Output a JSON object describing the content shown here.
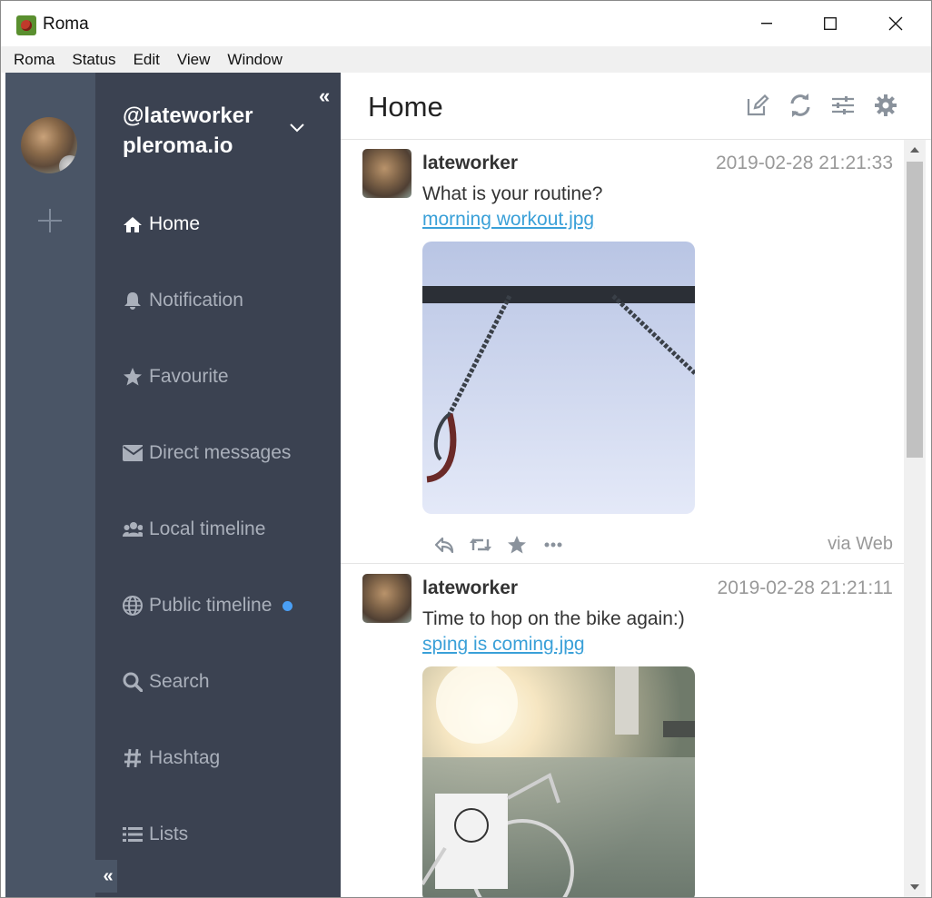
{
  "window": {
    "title": "Roma"
  },
  "menu": {
    "items": [
      "Roma",
      "Status",
      "Edit",
      "View",
      "Window"
    ]
  },
  "account": {
    "handle": "@lateworker",
    "domain": "pleroma.io"
  },
  "nav": {
    "items": [
      {
        "label": "Home",
        "icon": "home-icon",
        "active": true
      },
      {
        "label": "Notification",
        "icon": "bell-icon"
      },
      {
        "label": "Favourite",
        "icon": "star-icon"
      },
      {
        "label": "Direct messages",
        "icon": "envelope-icon"
      },
      {
        "label": "Local timeline",
        "icon": "users-icon"
      },
      {
        "label": "Public timeline",
        "icon": "globe-icon",
        "unread": true
      },
      {
        "label": "Search",
        "icon": "search-icon"
      },
      {
        "label": "Hashtag",
        "icon": "hashtag-icon"
      },
      {
        "label": "Lists",
        "icon": "list-icon"
      }
    ]
  },
  "header": {
    "title": "Home"
  },
  "statuses": [
    {
      "username": "lateworker",
      "timestamp": "2019-02-28 21:21:33",
      "text": "What is your routine?",
      "attachment": "morning workout.jpg",
      "via": "via Web"
    },
    {
      "username": "lateworker",
      "timestamp": "2019-02-28 21:21:11",
      "text": "Time to hop on the bike again:)",
      "attachment": "sping is coming.jpg"
    }
  ],
  "colors": {
    "sidebar": "#4a5566",
    "menu": "#3b4251",
    "link": "#3aa0d8",
    "unread_dot": "#4a9ff5"
  }
}
